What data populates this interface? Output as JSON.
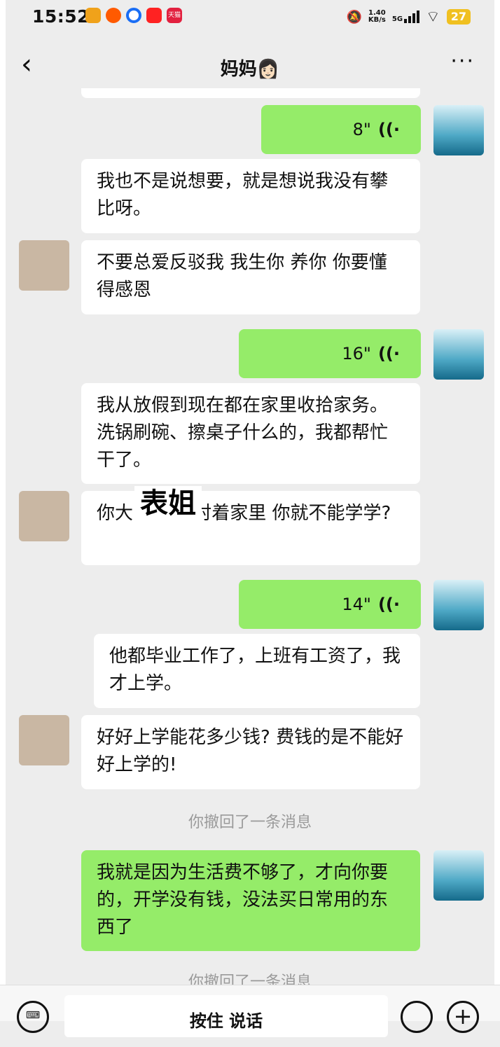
{
  "status": {
    "time": "15:52",
    "net_speed_value": "1.40",
    "net_speed_unit": "KB/s",
    "network": "5G",
    "battery": "27",
    "tmall_label": "天猫"
  },
  "header": {
    "title": "妈妈",
    "title_emoji": "👩🏻",
    "back_icon": "‹",
    "more_icon": "···"
  },
  "messages": [
    {
      "side": "right",
      "type": "voice",
      "duration": "8\""
    },
    {
      "side": "left",
      "type": "text",
      "text": "我也不是说想要，就是想说我没有攀比呀。"
    },
    {
      "side": "left",
      "type": "text",
      "text": "不要总爱反驳我 我生你 养你 你要懂得感恩"
    },
    {
      "side": "right",
      "type": "voice",
      "duration": "16\""
    },
    {
      "side": "left",
      "type": "text",
      "text": "我从放假到现在都在家里收拾家务。洗锅刷碗、擦桌子什么的，我都帮忙干了。"
    },
    {
      "side": "left",
      "type": "text",
      "text": "你大      令都帮衬着家里 你就不能学学?"
    },
    {
      "side": "right",
      "type": "voice",
      "duration": "14\""
    },
    {
      "side": "left",
      "type": "text",
      "text": "他都毕业工作了，上班有工资了，我才上学。"
    },
    {
      "side": "left",
      "type": "text",
      "text": "好好上学能花多少钱? 费钱的是不能好好上学的!"
    },
    {
      "side": "right",
      "type": "text",
      "text": "我就是因为生活费不够了，才向你要的，开学没有钱，没法买日常用的东西了"
    }
  ],
  "system": {
    "recalled_1": "你撤回了一条消息",
    "recalled_2": "你撤回了一条消息"
  },
  "overlay_label": "表姐",
  "input": {
    "hold_to_talk": "按住 说话"
  },
  "voice_icon": "((·"
}
